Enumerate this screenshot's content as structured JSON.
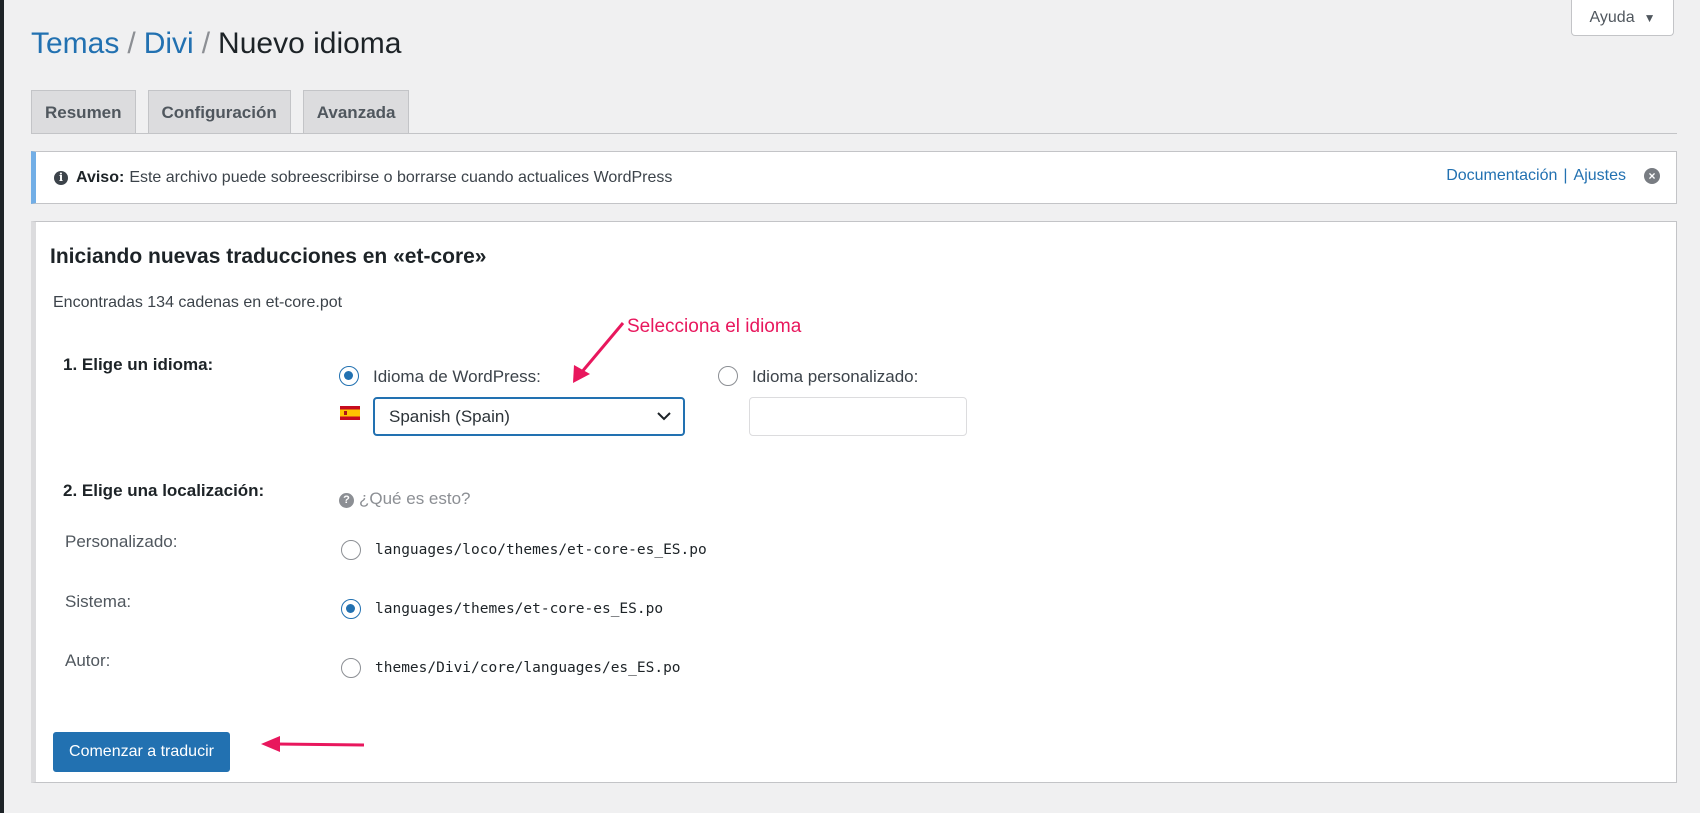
{
  "header": {
    "help_label": "Ayuda",
    "breadcrumb": {
      "item1": "Temas",
      "separator": "/",
      "item2": "Divi",
      "current": "Nuevo idioma"
    }
  },
  "tabs": [
    {
      "label": "Resumen"
    },
    {
      "label": "Configuración"
    },
    {
      "label": "Avanzada"
    }
  ],
  "notice": {
    "strong": "Aviso:",
    "text": "Este archivo puede sobreescribirse o borrarse cuando actualices WordPress",
    "links": {
      "docs": "Documentación",
      "separator": "|",
      "settings": "Ajustes"
    }
  },
  "panel": {
    "title": "Iniciando nuevas traducciones en «et-core»",
    "found_text": "Encontradas 134 cadenas en et-core.pot",
    "step1": {
      "label": "1. Elige un idioma:",
      "wp_option_label": "Idioma de WordPress:",
      "wp_selected": true,
      "select_value": "Spanish (Spain)",
      "custom_option_label": "Idioma personalizado:",
      "custom_selected": false,
      "custom_value": ""
    },
    "step2": {
      "label": "2. Elige una localización:",
      "help_text": "¿Qué es esto?",
      "locations": [
        {
          "label": "Personalizado:",
          "path": "languages/loco/themes/et-core-es_ES.po",
          "selected": false
        },
        {
          "label": "Sistema:",
          "path": "languages/themes/et-core-es_ES.po",
          "selected": true
        },
        {
          "label": "Autor:",
          "path": "themes/Divi/core/languages/es_ES.po",
          "selected": false
        }
      ]
    },
    "submit_label": "Comenzar a traducir"
  },
  "annotation": {
    "text": "Selecciona el idioma",
    "color": "#e8175d"
  },
  "colors": {
    "accent": "#2271b1",
    "notice_border": "#72aee6",
    "background": "#f0f0f1"
  },
  "icons": [
    "info-icon",
    "close-circle-icon",
    "caret-down-icon",
    "spain-flag-icon",
    "chevron-down-icon",
    "question-icon",
    "arrow-icon"
  ]
}
